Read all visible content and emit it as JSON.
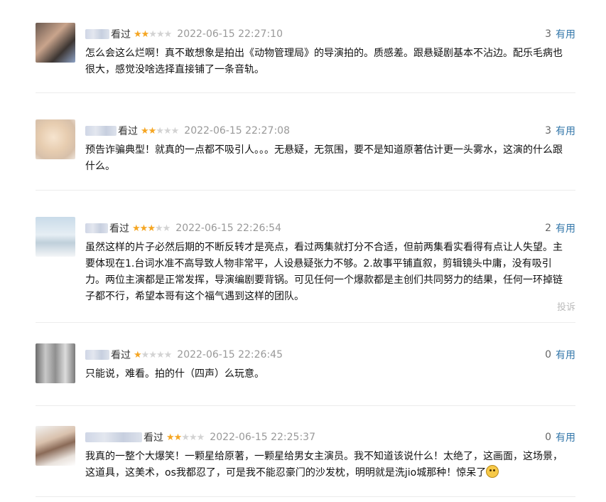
{
  "comments": [
    {
      "username": "用户",
      "status": "看过",
      "rating": 2,
      "time": "2022-06-15 22:27:10",
      "vote_count": "3",
      "vote_label": "有用",
      "text": "怎么会这么烂啊！真不敢想象是拍出《动物管理局》的导演拍的。质感差。跟悬疑剧基本不沾边。配乐毛病也很大，感觉没啥选择直接铺了一条音轨。"
    },
    {
      "username": "用户",
      "status": "看过",
      "rating": 2,
      "time": "2022-06-15 22:27:08",
      "vote_count": "3",
      "vote_label": "有用",
      "text": "预告诈骗典型！就真的一点都不吸引人。。。无悬疑，无氛围，要不是知道原著估计更一头雾水，这演的什么跟什么。"
    },
    {
      "username": "用户",
      "status": "看过",
      "rating": 3,
      "time": "2022-06-15 22:26:54",
      "vote_count": "2",
      "vote_label": "有用",
      "text": "虽然这样的片子必然后期的不断反转才是亮点，看过两集就打分不合适，但前两集看实看得有点让人失望。主要体现在1.台词水准不高导致人物非常平，人设悬疑张力不够。2.故事平铺直叙，剪辑镜头中庸，没有吸引力。两位主演都是正常发挥，导演编剧要背锅。可见任何一个爆款都是主创们共同努力的结果，任何一环掉链子都不行，希望本哥有这个福气遇到这样的团队。",
      "report_label": "投诉"
    },
    {
      "username": "用户",
      "status": "看过",
      "rating": 1,
      "time": "2022-06-15 22:26:45",
      "vote_count": "0",
      "vote_label": "有用",
      "text": "只能说，难看。拍的什（四声）么玩意。"
    },
    {
      "username": "用户",
      "status": "看过",
      "rating": 2,
      "time": "2022-06-15 22:25:37",
      "vote_count": "0",
      "vote_label": "有用",
      "text": "我真的一整个大爆笑！一颗星给原著，一颗星给男女主演员。我不知道该说什么！太绝了，这画面，这场景，这道具，这美术，os我都忍了，可是我不能忍豪门的沙发枕，明明就是洗jio城那种！惊呆了",
      "emoji": "astonished-face-emoji"
    }
  ],
  "colors": {
    "star_on": "#f5a623",
    "star_off": "#d3d3d3",
    "link": "#3377aa",
    "time": "#999999"
  }
}
